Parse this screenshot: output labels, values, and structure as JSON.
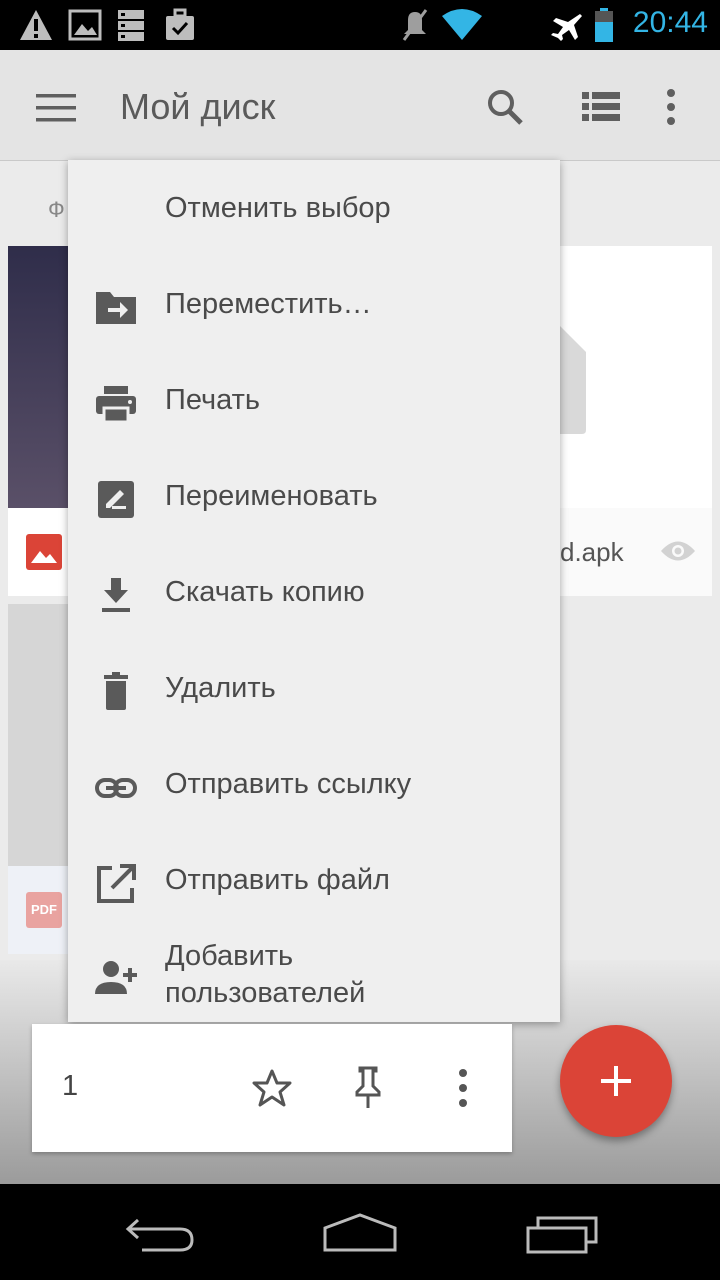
{
  "status_bar": {
    "time": "20:44",
    "icons": [
      "warning-icon",
      "image-icon",
      "storage-icon",
      "briefcase-check-icon",
      "mute-icon",
      "wifi-icon",
      "airplane-icon",
      "battery-icon"
    ]
  },
  "app_bar": {
    "title": "Мой диск",
    "icons": [
      "menu-icon",
      "search-icon",
      "list-view-icon",
      "more-vert-icon"
    ]
  },
  "content": {
    "section_label": "Ф",
    "file_name_fragment": "d.apk",
    "pdf_badge": "PDF"
  },
  "menu": {
    "items": [
      {
        "label": "Отменить выбор",
        "icon": ""
      },
      {
        "label": "Переместить…",
        "icon": "move-to-folder-icon"
      },
      {
        "label": "Печать",
        "icon": "print-icon"
      },
      {
        "label": "Переименовать",
        "icon": "rename-icon"
      },
      {
        "label": "Скачать копию",
        "icon": "download-icon"
      },
      {
        "label": "Удалить",
        "icon": "delete-icon"
      },
      {
        "label": "Отправить ссылку",
        "icon": "link-icon"
      },
      {
        "label": "Отправить файл",
        "icon": "open-in-new-icon"
      },
      {
        "label": "Добавить\nпользователей",
        "icon": "person-add-icon"
      }
    ]
  },
  "selection_bar": {
    "count": "1",
    "icons": [
      "star-icon",
      "pin-icon",
      "more-vert-icon"
    ]
  },
  "fab": {
    "icon": "plus-icon"
  },
  "colors": {
    "accent_red": "#db4437",
    "status_blue": "#33b5e5"
  },
  "nav_bar": {
    "icons": [
      "back-icon",
      "home-icon",
      "recents-icon"
    ]
  }
}
